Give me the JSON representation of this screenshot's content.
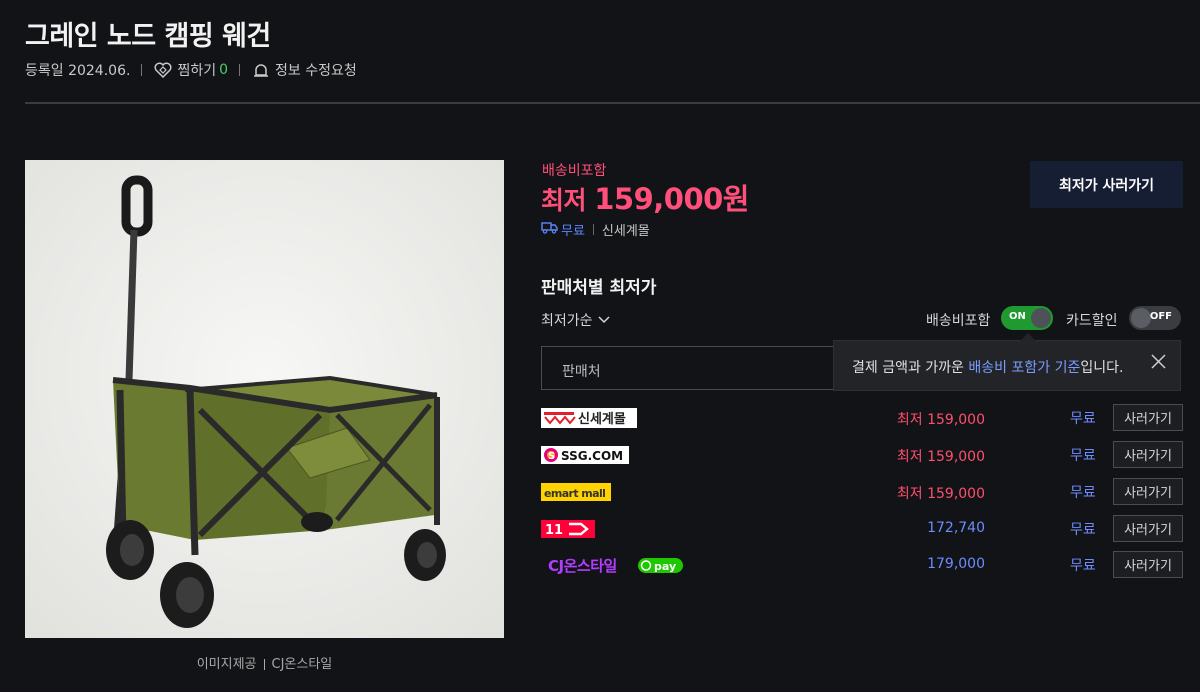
{
  "product": {
    "title": "그레인 노드 캠핑 웨건",
    "registered": "등록일 2024.06.",
    "wishlist_label": "찜하기",
    "wishlist_count": "0",
    "report_label": "정보 수정요청"
  },
  "image_credit": {
    "label": "이미지제공",
    "source": "CJ온스타일"
  },
  "price_summary": {
    "shipping_included": "배송비포함",
    "prefix": "최저 ",
    "price": "159,000원",
    "shipping": "무료",
    "store": "신세계몰",
    "buy_label": "최저가 사러가기"
  },
  "offers_section": {
    "title": "판매처별 최저가",
    "sort_label": "최저가순",
    "toggle_shipping": {
      "label": "배송비포함",
      "state": "ON"
    },
    "toggle_card": {
      "label": "카드할인",
      "state": "OFF"
    },
    "filter_placeholder": "판매처",
    "tooltip": {
      "text_before": "결제 금액과 가까운 ",
      "highlight": "배송비 포함가 기준",
      "text_after": "입니다."
    }
  },
  "offers": [
    {
      "store": "신세계몰",
      "logo_icon": "shinsegae-mall-logo",
      "price": "최저 159,000",
      "highlight": true,
      "shipping": "무료",
      "buy_label": "사러가기"
    },
    {
      "store": "SSG.COM",
      "logo_icon": "ssg-com-logo",
      "price": "최저 159,000",
      "highlight": true,
      "shipping": "무료",
      "buy_label": "사러가기"
    },
    {
      "store": "emart mall",
      "logo_icon": "emart-mall-logo",
      "price": "최저 159,000",
      "highlight": true,
      "shipping": "무료",
      "buy_label": "사러가기"
    },
    {
      "store": "11",
      "logo_icon": "11st-logo",
      "price": "172,740",
      "highlight": false,
      "shipping": "무료",
      "buy_label": "사러가기"
    },
    {
      "store": "CJ온스타일",
      "logo_icon": "cj-onstyle-logo",
      "badge": "pay",
      "price": "179,000",
      "highlight": false,
      "shipping": "무료",
      "buy_label": "사러가기"
    }
  ],
  "colors": {
    "background": "#121316",
    "accent_price": "#ff4f7a",
    "link_blue": "#6c8cff",
    "toggle_on": "#1f9a30",
    "buy_button": "#161e33"
  }
}
